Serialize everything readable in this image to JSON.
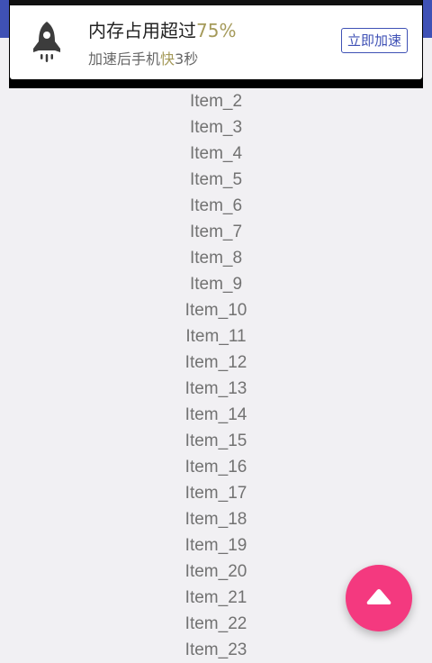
{
  "colors": {
    "primary": "#3f51b5",
    "accent": "#f4397f",
    "highlight": "#a59a5a",
    "background": "#f1f0f3"
  },
  "notification": {
    "icon": "rocket-icon",
    "title_prefix": "内存占用超过",
    "title_value": "75%",
    "subtitle_prefix": "加速后手机",
    "subtitle_highlight": "快",
    "subtitle_suffix": "3秒",
    "button_label": "立即加速"
  },
  "list": {
    "items": [
      "Item_2",
      "Item_3",
      "Item_4",
      "Item_5",
      "Item_6",
      "Item_7",
      "Item_8",
      "Item_9",
      "Item_10",
      "Item_11",
      "Item_12",
      "Item_13",
      "Item_14",
      "Item_15",
      "Item_16",
      "Item_17",
      "Item_18",
      "Item_19",
      "Item_20",
      "Item_21",
      "Item_22",
      "Item_23"
    ]
  },
  "fab": {
    "icon": "arrow-up-icon"
  }
}
